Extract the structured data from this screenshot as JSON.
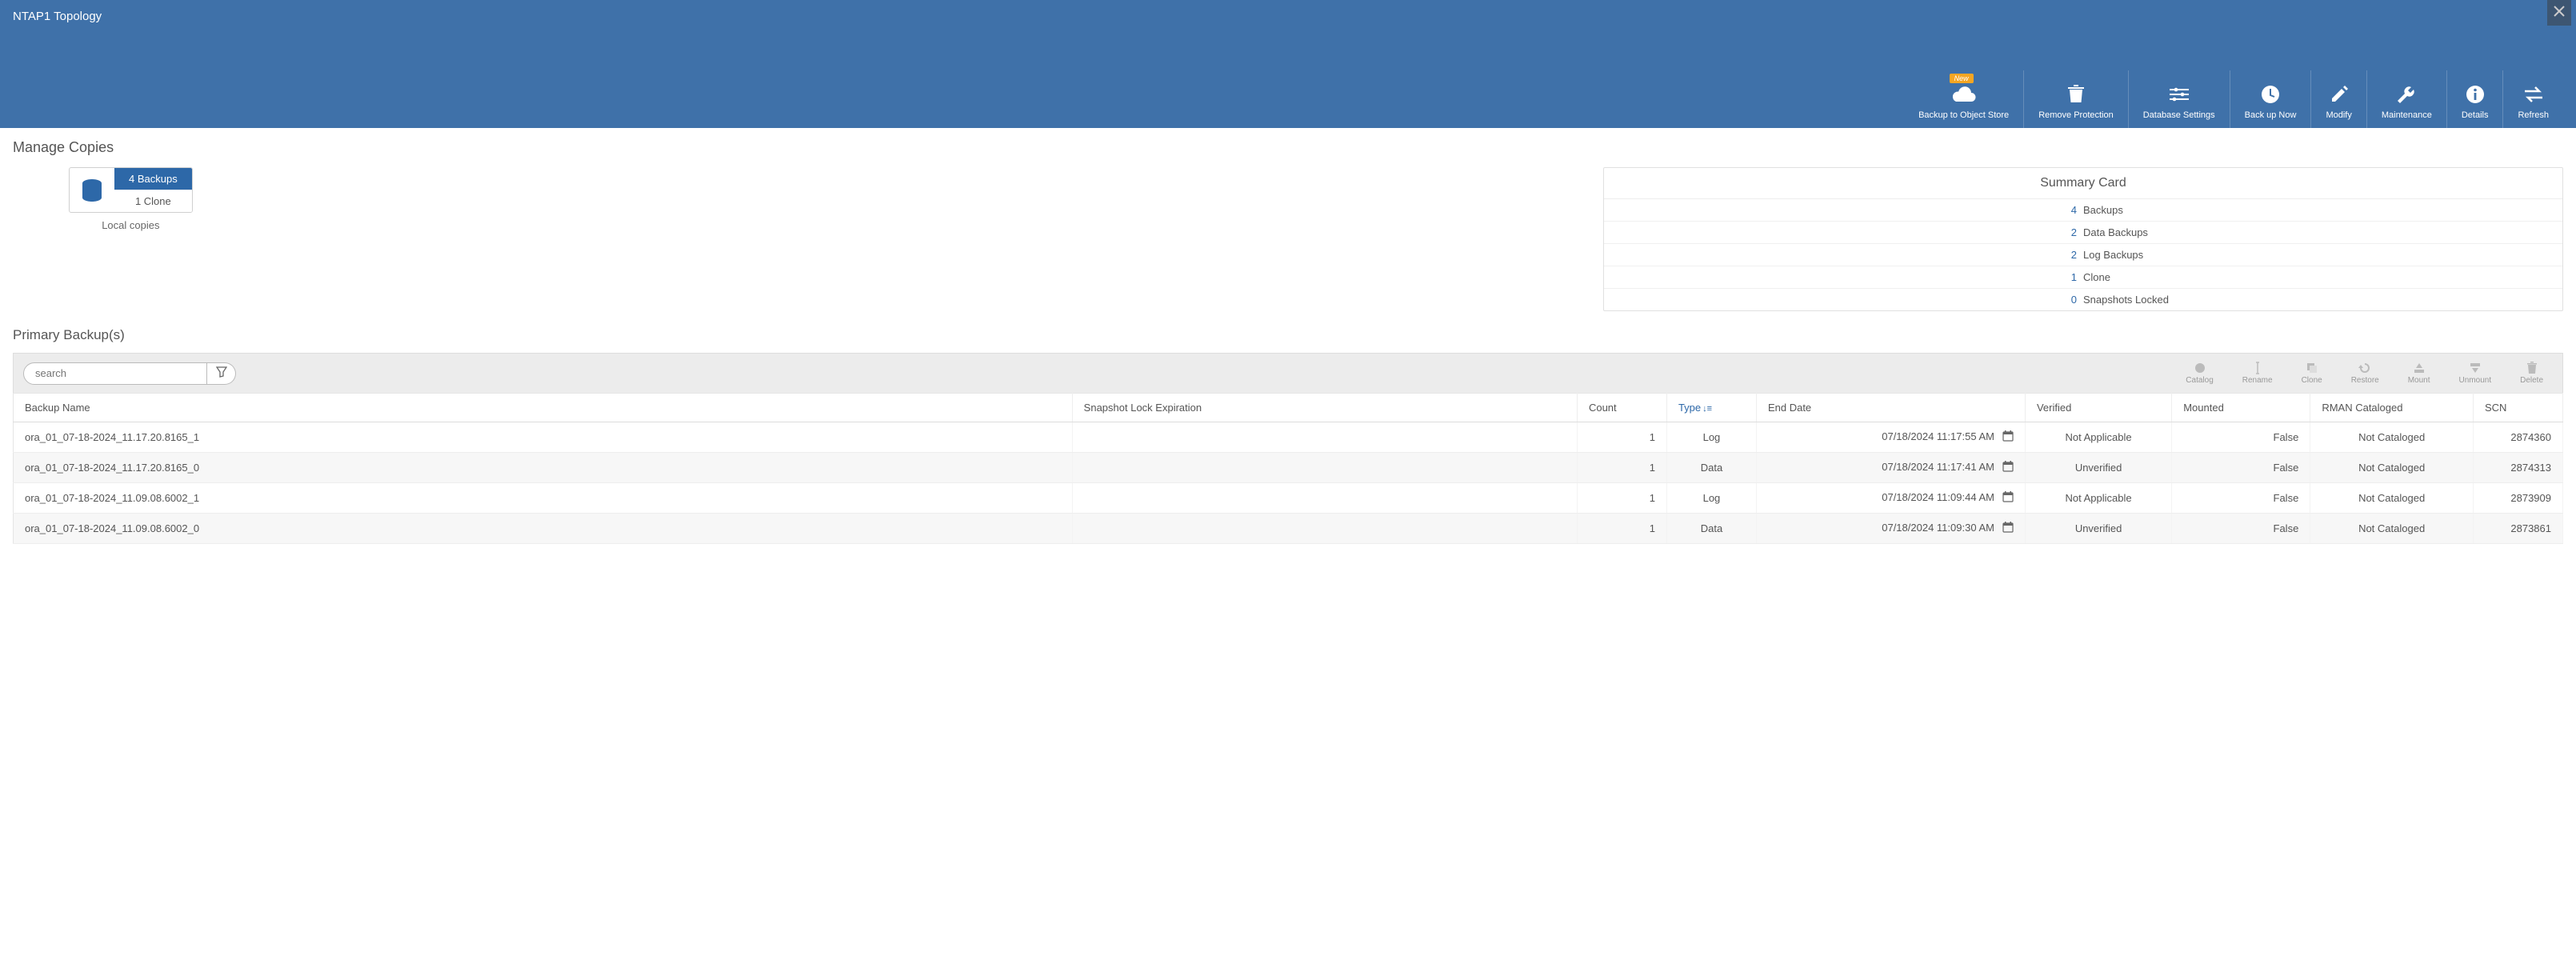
{
  "header": {
    "title": "NTAP1 Topology",
    "new_badge": "New"
  },
  "toolbar": {
    "backup_object_store": "Backup to Object Store",
    "remove_protection": "Remove Protection",
    "database_settings": "Database Settings",
    "back_up_now": "Back up Now",
    "modify": "Modify",
    "maintenance": "Maintenance",
    "details": "Details",
    "refresh": "Refresh"
  },
  "manage_copies": {
    "heading": "Manage Copies",
    "backups_pill": "4 Backups",
    "clone_pill": "1 Clone",
    "local_label": "Local copies"
  },
  "summary": {
    "title": "Summary Card",
    "rows": [
      {
        "num": "4",
        "label": "Backups"
      },
      {
        "num": "2",
        "label": "Data Backups"
      },
      {
        "num": "2",
        "label": "Log Backups"
      },
      {
        "num": "1",
        "label": "Clone"
      },
      {
        "num": "0",
        "label": "Snapshots Locked"
      }
    ]
  },
  "primary": {
    "heading": "Primary Backup(s)",
    "search_placeholder": "search"
  },
  "actions": {
    "catalog": "Catalog",
    "rename": "Rename",
    "clone": "Clone",
    "restore": "Restore",
    "mount": "Mount",
    "unmount": "Unmount",
    "delete": "Delete"
  },
  "table": {
    "headers": {
      "name": "Backup Name",
      "snap": "Snapshot Lock Expiration",
      "count": "Count",
      "type": "Type",
      "end": "End Date",
      "verified": "Verified",
      "mounted": "Mounted",
      "cataloged": "RMAN Cataloged",
      "scn": "SCN"
    },
    "rows": [
      {
        "name": "ora_01_07-18-2024_11.17.20.8165_1",
        "snap": "",
        "count": "1",
        "type": "Log",
        "end": "07/18/2024 11:17:55 AM",
        "verified": "Not Applicable",
        "mounted": "False",
        "cataloged": "Not Cataloged",
        "scn": "2874360"
      },
      {
        "name": "ora_01_07-18-2024_11.17.20.8165_0",
        "snap": "",
        "count": "1",
        "type": "Data",
        "end": "07/18/2024 11:17:41 AM",
        "verified": "Unverified",
        "mounted": "False",
        "cataloged": "Not Cataloged",
        "scn": "2874313"
      },
      {
        "name": "ora_01_07-18-2024_11.09.08.6002_1",
        "snap": "",
        "count": "1",
        "type": "Log",
        "end": "07/18/2024 11:09:44 AM",
        "verified": "Not Applicable",
        "mounted": "False",
        "cataloged": "Not Cataloged",
        "scn": "2873909"
      },
      {
        "name": "ora_01_07-18-2024_11.09.08.6002_0",
        "snap": "",
        "count": "1",
        "type": "Data",
        "end": "07/18/2024 11:09:30 AM",
        "verified": "Unverified",
        "mounted": "False",
        "cataloged": "Not Cataloged",
        "scn": "2873861"
      }
    ]
  }
}
